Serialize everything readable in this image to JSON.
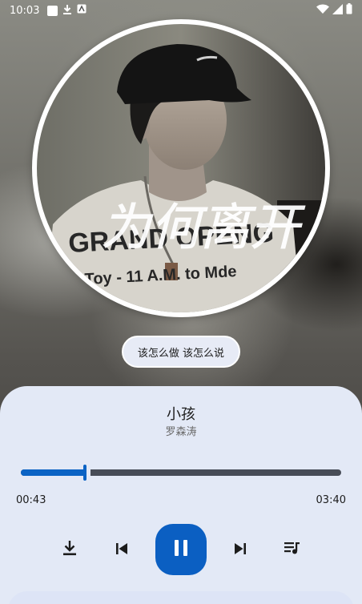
{
  "status_bar": {
    "time": "10:03",
    "icons": [
      "notification-square-icon",
      "download-icon",
      "app-icon"
    ],
    "right_icons": [
      "wifi-icon",
      "signal-icon",
      "battery-icon"
    ]
  },
  "album": {
    "calligraphy_text": "为何离开",
    "shirt_text_line1": "GRAND OPENG",
    "shirt_text_line2": "Toy - 11 A.M. to Mde"
  },
  "lyric": {
    "current_line": "该怎么做 该怎么说"
  },
  "song": {
    "title": "小孩",
    "artist": "罗森涛"
  },
  "playback": {
    "current_time": "00:43",
    "total_time": "03:40",
    "progress_fraction": 0.2
  },
  "controls": {
    "download": "download-icon",
    "previous": "skip-previous-icon",
    "play_pause": "pause-icon",
    "next": "skip-next-icon",
    "playlist": "queue-music-icon"
  },
  "colors": {
    "accent": "#0b5fc2",
    "sheet_background": "#e3e9f6",
    "track": "#474c57"
  }
}
